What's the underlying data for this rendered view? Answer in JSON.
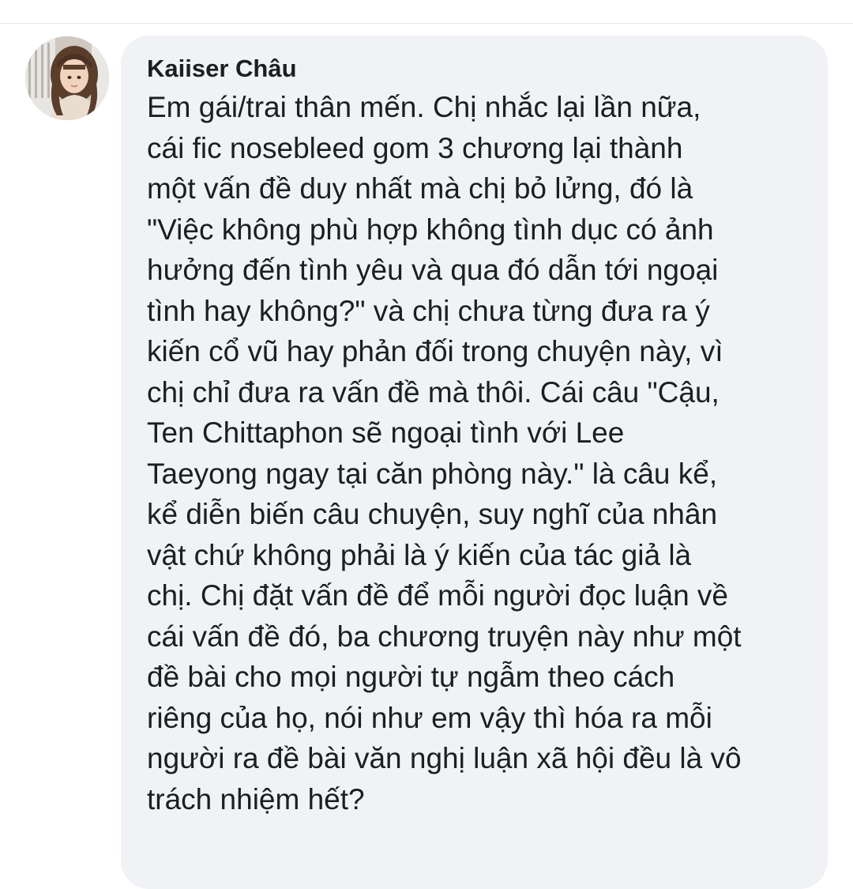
{
  "comment": {
    "author": "Kaiiser Châu",
    "lines": [
      "Em gái/trai thân mến. Chị nhắc lại lần nữa,",
      "cái fic nosebleed gom 3 chương lại thành",
      "một vấn đề duy nhất mà chị bỏ lửng, đó là",
      "\"Việc không phù hợp không tình dục có ảnh",
      "hưởng đến tình yêu và qua đó dẫn tới ngoại",
      "tình hay không?\" và chị chưa từng đưa ra ý",
      "kiến cổ vũ hay phản đối trong chuyện này, vì",
      "chị chỉ đưa ra vấn đề mà thôi. Cái câu \"Cậu,",
      "Ten Chittaphon sẽ ngoại tình với Lee",
      "Taeyong ngay tại căn phòng này.\" là câu kể,",
      "kể diễn biến câu chuyện, suy nghĩ của nhân",
      "vật chứ không phải là ý kiến của tác giả là",
      "chị. Chị đặt vấn đề để mỗi người đọc luận về",
      "cái vấn đề đó, ba chương truyện này như một",
      "đề bài cho mọi người tự ngẫm theo cách",
      "riêng của họ, nói như em vậy thì hóa ra mỗi",
      "người ra đề bài văn nghị luận xã hội đều là vô",
      "trách nhiệm hết?"
    ]
  }
}
